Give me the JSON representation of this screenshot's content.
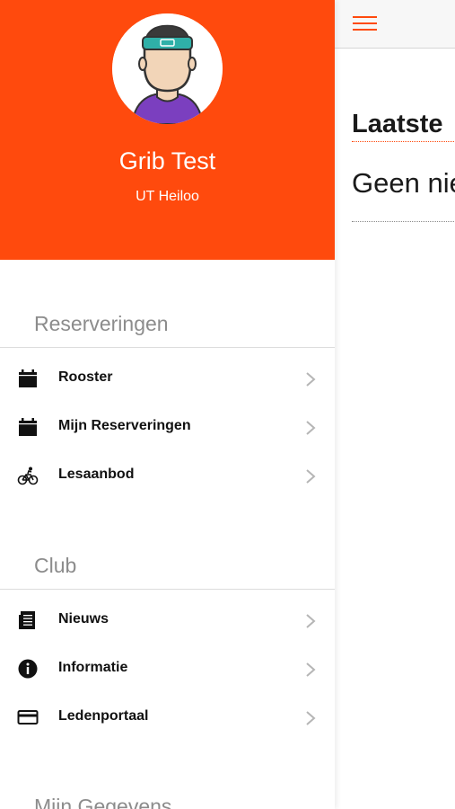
{
  "main": {
    "title": "Laatste",
    "empty_message": "Geen nie"
  },
  "drawer": {
    "user": {
      "name": "Grib Test",
      "club": "UT Heiloo"
    },
    "sections": [
      {
        "header": "Reserveringen",
        "items": [
          {
            "label": "Rooster",
            "icon": "calendar-icon"
          },
          {
            "label": "Mijn Reserveringen",
            "icon": "calendar-icon"
          },
          {
            "label": "Lesaanbod",
            "icon": "cyclist-icon"
          }
        ]
      },
      {
        "header": "Club",
        "items": [
          {
            "label": "Nieuws",
            "icon": "newspaper-icon"
          },
          {
            "label": "Informatie",
            "icon": "info-icon"
          },
          {
            "label": "Ledenportaal",
            "icon": "credit-card-icon"
          }
        ]
      },
      {
        "header": "Mijn Gegevens",
        "items": []
      }
    ]
  },
  "colors": {
    "accent": "#ff4a0d",
    "section_header": "#8c8c8c",
    "avatar_shirt": "#7b3fbf",
    "avatar_band": "#2fb0a8"
  }
}
